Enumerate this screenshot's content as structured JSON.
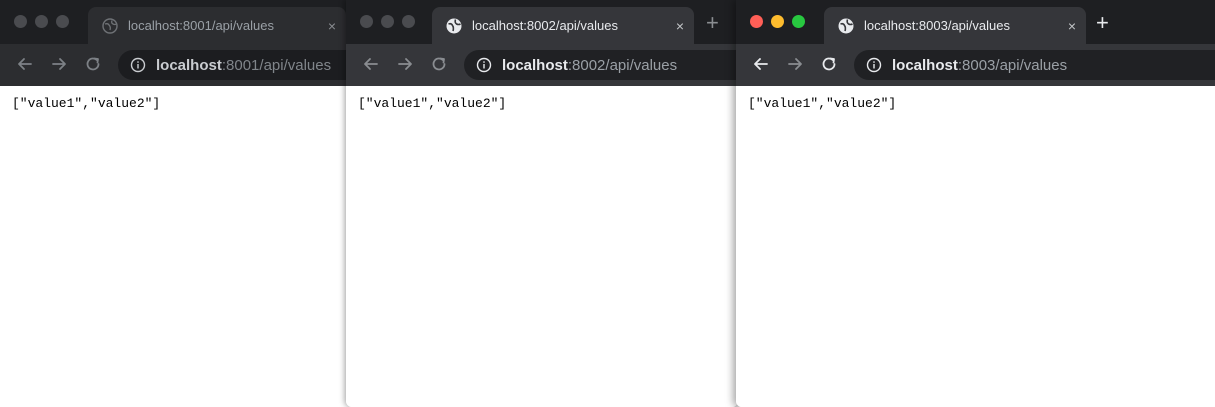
{
  "windows": [
    {
      "tab_title": "localhost:8001/api/values",
      "tab_close": "×",
      "url_host": "localhost",
      "url_rest": ":8001/api/values",
      "body": "[\"value1\",\"value2\"]"
    },
    {
      "tab_title": "localhost:8002/api/values",
      "tab_close": "×",
      "new_tab": "+",
      "url_host": "localhost",
      "url_rest": ":8002/api/values",
      "body": "[\"value1\",\"value2\"]"
    },
    {
      "tab_title": "localhost:8003/api/values",
      "tab_close": "×",
      "new_tab": "+",
      "url_host": "localhost",
      "url_rest": ":8003/api/values",
      "body": "[\"value1\",\"value2\"]"
    }
  ],
  "icons": {
    "favicon": "globe-icon",
    "back": "arrow-left-icon",
    "forward": "arrow-right-icon",
    "reload": "reload-icon",
    "info": "info-icon",
    "close": "close-icon"
  },
  "colors": {
    "traffic_red": "#ff5f57",
    "traffic_yellow": "#febc2e",
    "traffic_green": "#28c840",
    "chrome_dark": "#1e1f22",
    "tab_active": "#35363a"
  }
}
